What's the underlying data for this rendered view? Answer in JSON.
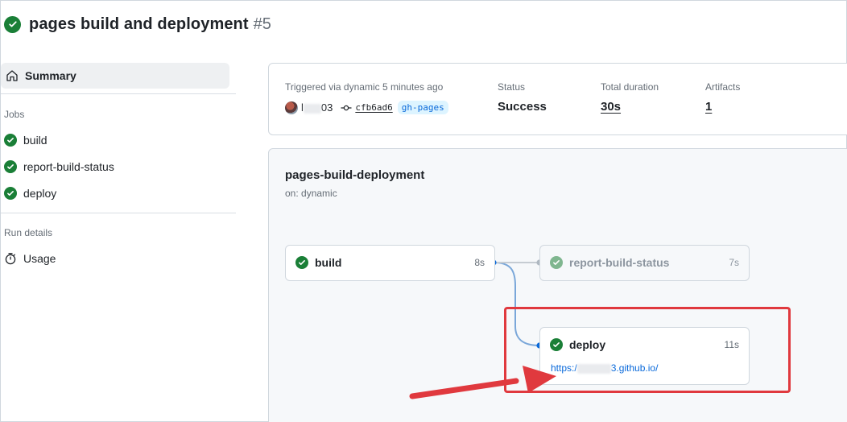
{
  "header": {
    "title": "pages build and deployment",
    "run_number": "#5"
  },
  "sidebar": {
    "summary_label": "Summary",
    "jobs_section": "Jobs",
    "jobs": [
      {
        "label": "build",
        "status": "success"
      },
      {
        "label": "report-build-status",
        "status": "success"
      },
      {
        "label": "deploy",
        "status": "success"
      }
    ],
    "run_details_section": "Run details",
    "usage_label": "Usage"
  },
  "summary": {
    "triggered_label": "Triggered via dynamic 5 minutes ago",
    "actor_prefix": "l",
    "actor_suffix": "03",
    "commit_sha": "cfb6ad6",
    "branch": "gh-pages",
    "status_label": "Status",
    "status_value": "Success",
    "duration_label": "Total duration",
    "duration_value": "30s",
    "artifacts_label": "Artifacts",
    "artifacts_value": "1"
  },
  "workflow": {
    "name": "pages-build-deployment",
    "trigger": "on: dynamic",
    "jobs": {
      "build": {
        "name": "build",
        "duration": "8s"
      },
      "report": {
        "name": "report-build-status",
        "duration": "7s"
      },
      "deploy": {
        "name": "deploy",
        "duration": "11s",
        "url_prefix": "https:/",
        "url_suffix": "3.github.io/"
      }
    }
  },
  "colors": {
    "success": "#1a7f37",
    "link": "#0969da",
    "annotation": "#e0393e"
  }
}
